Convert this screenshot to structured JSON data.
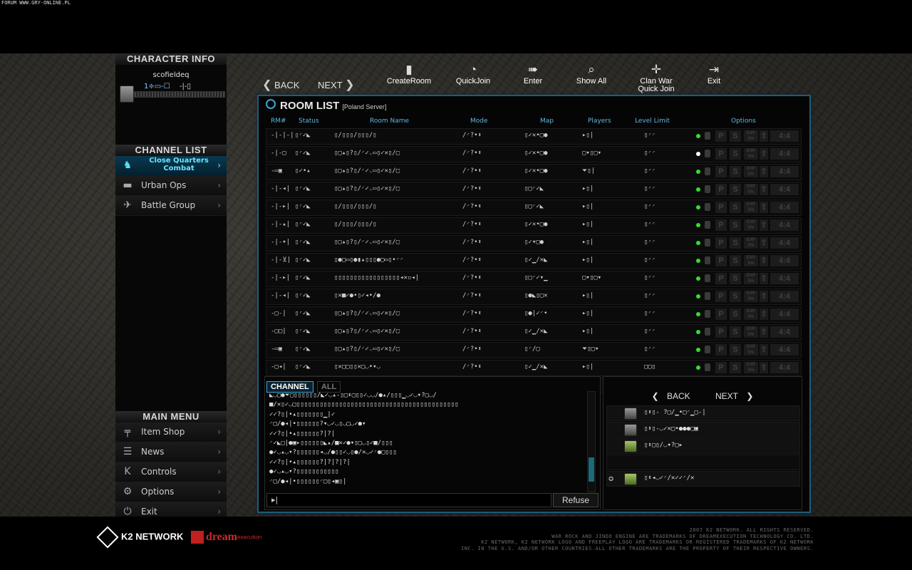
{
  "watermark": "FORUM WWW.GRY-ONLINE.PL",
  "character": {
    "header": "CHARACTER INFO",
    "name": "scofieldeq",
    "stats_left": "1≑▭-☐",
    "stats_right": "-|-▯"
  },
  "channels": {
    "header": "CHANNEL LIST",
    "items": [
      {
        "label": "Close Quarters Combat",
        "icon": "soldier-icon",
        "glyph": "♞"
      },
      {
        "label": "Urban Ops",
        "icon": "tank-icon",
        "glyph": "▬"
      },
      {
        "label": "Battle Group",
        "icon": "jet-icon",
        "glyph": "✈"
      }
    ]
  },
  "main_menu": {
    "header": "MAIN MENU",
    "items": [
      {
        "label": "Item Shop",
        "icon": "gun-icon",
        "glyph": "╤"
      },
      {
        "label": "News",
        "icon": "news-icon",
        "glyph": "☰"
      },
      {
        "label": "Controls",
        "icon": "keyboard-icon",
        "glyph": "K"
      },
      {
        "label": "Options",
        "icon": "gear-icon",
        "glyph": "⚙"
      },
      {
        "label": "Exit",
        "icon": "power-icon",
        "glyph": "⏻"
      }
    ]
  },
  "toolbar": {
    "back": "BACK",
    "next": "NEXT",
    "tools": [
      {
        "label": "CreateRoom",
        "icon": "door-icon",
        "glyph": "▮"
      },
      {
        "label": "QuickJoin",
        "icon": "quickjoin-icon",
        "glyph": "◔"
      },
      {
        "label": "Enter",
        "icon": "enter-icon",
        "glyph": "➠"
      },
      {
        "label": "Show All",
        "icon": "search-icon",
        "glyph": "⌕"
      },
      {
        "label": "Clan War Quick Join",
        "icon": "crosshair-icon",
        "glyph": "✛"
      },
      {
        "label": "Exit",
        "icon": "exit-icon",
        "glyph": "⇥"
      }
    ]
  },
  "room_list": {
    "title": "ROOM LIST",
    "server": "[Poland Server]",
    "columns": {
      "rm": "RM#",
      "status": "Status",
      "name": "Room Name",
      "mode": "Mode",
      "map": "Map",
      "players": "Players",
      "level": "Level Limit",
      "options": "Options"
    },
    "option_labels": {
      "p": "P",
      "s": "S",
      "exp": "EXP 5%",
      "arrow": "⇧",
      "ratio": "4:4"
    },
    "rows": [
      {
        "rm": "-|-|-|",
        "status": "▯◜✓◣",
        "name": "▯/▯▯▯/▯▯▯/▯",
        "mode": "/◜?•⬍",
        "map": "▯✓✕•▢●",
        "players": "▸▯|",
        "level": "▯◜◜",
        "status_dot": "green"
      },
      {
        "rm": "-|-▢",
        "status": "▯◜✓◣",
        "name": "▯▢▴▯?▯/◜✓◟▭▯✓✕▯/▢",
        "mode": "/◜?•⬍",
        "map": "▯✓✕•▢●",
        "players": "▢▾▯▢▾",
        "level": "▯◜◜",
        "status_dot": "white"
      },
      {
        "rm": "-▭▣",
        "status": "▯✓•▴",
        "name": "▯▢▴▯?▯/◜✓◟▭▯✓✕▯/▢",
        "mode": "/◜?•⬍",
        "map": "▯✓✕•▢●",
        "players": "⏷▯|",
        "level": "▯◜◜",
        "status_dot": "green"
      },
      {
        "rm": "-|-◂|",
        "status": "▯◜✓◣",
        "name": "▯▢▴▯?▯/◜✓◟▭▯✓✕▯/▢",
        "mode": "/◜?•⬍",
        "map": "▯▢◜✓◣",
        "players": "▸▯|",
        "level": "▯◜◜",
        "status_dot": "green"
      },
      {
        "rm": "-|-▸|",
        "status": "▯◜✓◣",
        "name": "▯/▯▯▯/▯▯▯/▯",
        "mode": "/◜?•⬍",
        "map": "▯▢◜✓◣",
        "players": "▸▯|",
        "level": "▯◜◜",
        "status_dot": "green"
      },
      {
        "rm": "-|-▴|",
        "status": "▯◜✓◣",
        "name": "▯/▯▯▯/▯▯▯/▯",
        "mode": "/◜?•⬍",
        "map": "▯✓✕•▢●",
        "players": "▸▯|",
        "level": "▯◜◜",
        "status_dot": "green"
      },
      {
        "rm": "-|-▾|",
        "status": "▯◜✓◣",
        "name": "▯▢▴▯?▯/◜✓◟▭▯✓✕▯/▢",
        "mode": "/◜?•⬍",
        "map": "▯✓▾▢●",
        "players": "▸▯|",
        "level": "▯◜◜",
        "status_dot": "green"
      },
      {
        "rm": "-|-⊻|",
        "status": "▯◜✓◣",
        "name": "▯●▢▭▯●▮▴▯▯▯●▢▭▯•◜◜",
        "mode": "/◜?•⬍",
        "map": "▯✓▁/✕◣",
        "players": "▸▯|",
        "level": "▯◜◜",
        "status_dot": "green"
      },
      {
        "rm": "-|-▸|",
        "status": "▯◜✓◣",
        "name": "▯▯▯▯▯▯▯▯▯▯▯▯▯▯▯▯▯◂✕▫◂|",
        "mode": "/◜?•⬍",
        "map": "▯▢◜✓▾▁",
        "players": "▢▾▯▢▾",
        "level": "▯◜◜",
        "status_dot": "green"
      },
      {
        "rm": "-|-◂|",
        "status": "▯◜✓◣",
        "name": "▯✕■✓●•▯✓◂•/●",
        "mode": "/◜?•⬍",
        "map": "▯●◣▯▢✕",
        "players": "▸▯|",
        "level": "▯◜◜",
        "status_dot": "green"
      },
      {
        "rm": "-▢-|",
        "status": "▯◜✓◣",
        "name": "▯▢▴▯?▯/◜✓◟▭▯✓✕▯/▢",
        "mode": "/◜?•⬍",
        "map": "▯●|✓◜•",
        "players": "▸▯|",
        "level": "▯◜◜",
        "status_dot": "green"
      },
      {
        "rm": "-▢▢|",
        "status": "▯◜✓◣",
        "name": "▯▢▴▯?▯/◜✓◟▭▯✓✕▯/▢",
        "mode": "/◜?•⬍",
        "map": "▯✓▁/✕◣",
        "players": "▸▯|",
        "level": "▯◜◜",
        "status_dot": "green"
      },
      {
        "rm": "-▭▣",
        "status": "▯◜✓◣",
        "name": "▯▢▴▯?▯/◜✓◟▭▯✓✕▯/▢",
        "mode": "/◜?•⬍",
        "map": "▯◜/▢",
        "players": "⏷▯▢▾",
        "level": "▯◜◜",
        "status_dot": "green"
      },
      {
        "rm": "-▢◂|",
        "status": "▯◜✓◣",
        "name": "▯✕▢▢▯▯✕▢◡•▾◡",
        "mode": "/◜?•⬍",
        "map": "▯✓▁/✕◣",
        "players": "▸▯|",
        "level": "▢▢▯",
        "status_dot": "green"
      },
      {
        "rm": "-|-◂|",
        "status": "▯◜✓◣",
        "name": "▯/▯▯▯/▯▯▯/▯",
        "mode": "/◜?•⬍",
        "map": "▯▢◜✕▾▁",
        "players": "▸▯|",
        "level": "▯◜◜",
        "status_dot": "green"
      }
    ]
  },
  "chat": {
    "tab_channel": "CHANNEL",
    "tab_all": "ALL",
    "lines": [
      "◣◡▢●⏷▢▯▯▯▯▯▯/◣✓◡▴-▯▢⬍▢▯▯✓◡◡/●▴/▯▯▯▁◡✓◡▾?▢◡/",
      "■/✕▯✓◡▢▯▯▯▯▯▯▯▯▯▯▯▯▯▯▯▯▯▯▯▯▯▯▯▯▯▯▯▯▯▯▯▯▯▯▯▯▯▯▯▯▯▯",
      "✓✓?▯|•▴▯▯▯▯▯▯▯▁|✓",
      "◜▢/●◂|•▯▯▯▯▯▯?▾◡✓◡▯◡▢◡✓●▾",
      "✓✓?▯|•▴▯▯▯▯▯▯?|?|",
      "◜✓◣▢|●▣▸▯▯▯▯▯▯◣▴/■✕✓●▾▯▢◡▯✓■/▯▯▯",
      "●✓◡▴◡▾?▯▯▯▯▯▯◂◡/●▯▯✓◡▯●/✕◡✓◜●▢▯▯▯",
      "✓✓?▯|•▴▯▯▯▯▯▯?|?|?|?|",
      "●✓◡▴◡▾?▯▯▯▯▯▯▯▯▯▯▯",
      "◜▢/●◂|•▯▯▯▯▯▯◜▢▯◂▣▯|"
    ],
    "input_value": "",
    "refuse": "Refuse"
  },
  "userlist": {
    "back": "BACK",
    "next": "NEXT",
    "users": [
      {
        "name": "▯⬍▯- ?▢/▁•▢◜▁▢-|",
        "badge": "grey"
      },
      {
        "name": "▯⬍▯-◡✓✕▢•●●●▢▣",
        "badge": "grey"
      },
      {
        "name": "▯⬍▢▯/◡▾?▢▸",
        "badge": "green"
      },
      {
        "name": "▯⬍◂◡✓◜/✕✓✓◜/✕",
        "badge": "green"
      }
    ]
  },
  "footer": {
    "k2_label": "K2 NETWORK",
    "dream_label": "dream",
    "dream_sub": "execution",
    "legal": [
      "2007 K2 NETWORK. ALL RIGHTS RESERVED.",
      "WAR ROCK AND JINDO ENGINE ARE TRADEMARKS OF DREAMEXECUTION TECHNOLOGY CO. LTD.",
      "K2 NETWORK, K2 NETWORK LOGO AND FREEPLAY LOGO ARE TRADEMARKS OR REGISTERED TRADEMARKS OF K2 NETWORK",
      "INC. IN THE U.S. AND/OR OTHER COUNTRIES.ALL OTHER TRADEMARKS ARE THE PROPERTY OF THEIR RESPECTIVE OWNERS."
    ]
  },
  "colors": {
    "accent": "#3aa7d8",
    "channel_active": "#6ce2ff",
    "online": "#33dd33"
  }
}
